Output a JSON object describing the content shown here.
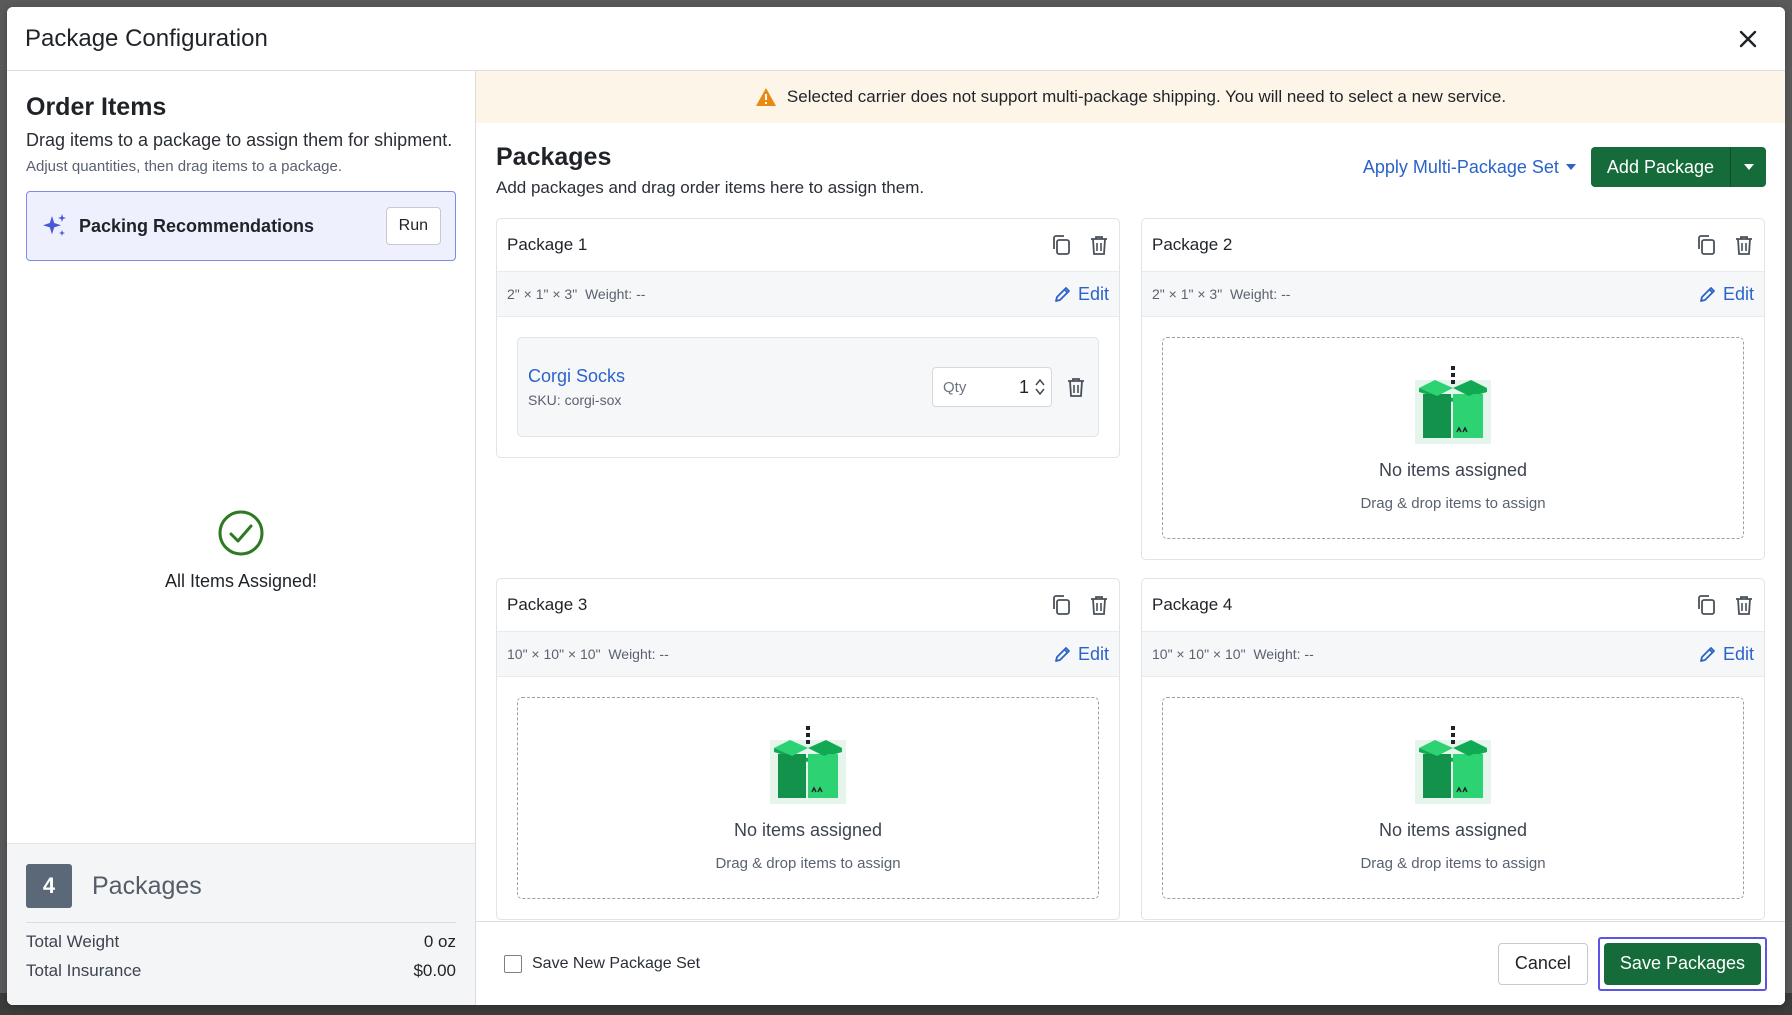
{
  "modal": {
    "title": "Package Configuration"
  },
  "left": {
    "title": "Order Items",
    "subtitle": "Drag items to a package to assign them for shipment.",
    "hint": "Adjust quantities, then drag items to a package.",
    "recommendations": {
      "label": "Packing Recommendations",
      "run_label": "Run"
    },
    "assigned_text": "All Items Assigned!",
    "summary": {
      "package_count": "4",
      "packages_label": "Packages",
      "total_weight_label": "Total Weight",
      "total_weight_value": "0 oz",
      "total_insurance_label": "Total Insurance",
      "total_insurance_value": "$0.00"
    }
  },
  "warning": {
    "text": "Selected carrier does not support multi-package shipping. You will need to select a new service."
  },
  "packages_section": {
    "title": "Packages",
    "subtitle": "Add packages and drag order items here to assign them.",
    "apply_set_label": "Apply Multi-Package Set",
    "add_package_label": "Add Package"
  },
  "packages": [
    {
      "name": "Package 1",
      "dims": "2\" × 1\" × 3\"",
      "weight": "Weight: --",
      "edit_label": "Edit",
      "item": {
        "name": "Corgi Socks",
        "sku": "SKU: corgi-sox",
        "qty_label": "Qty",
        "qty_value": "1"
      }
    },
    {
      "name": "Package 2",
      "dims": "2\" × 1\" × 3\"",
      "weight": "Weight: --",
      "edit_label": "Edit",
      "empty_title": "No items assigned",
      "empty_sub": "Drag & drop items to assign"
    },
    {
      "name": "Package 3",
      "dims": "10\" × 10\" × 10\"",
      "weight": "Weight: --",
      "edit_label": "Edit",
      "empty_title": "No items assigned",
      "empty_sub": "Drag & drop items to assign"
    },
    {
      "name": "Package 4",
      "dims": "10\" × 10\" × 10\"",
      "weight": "Weight: --",
      "edit_label": "Edit",
      "empty_title": "No items assigned",
      "empty_sub": "Drag & drop items to assign"
    }
  ],
  "footer": {
    "save_set_label": "Save New Package Set",
    "cancel_label": "Cancel",
    "save_label": "Save Packages"
  },
  "colors": {
    "primary_green": "#156b3a",
    "link_blue": "#2b63c9",
    "warning_bg": "#fdf5e8",
    "focus_outline": "#5a55e4"
  }
}
